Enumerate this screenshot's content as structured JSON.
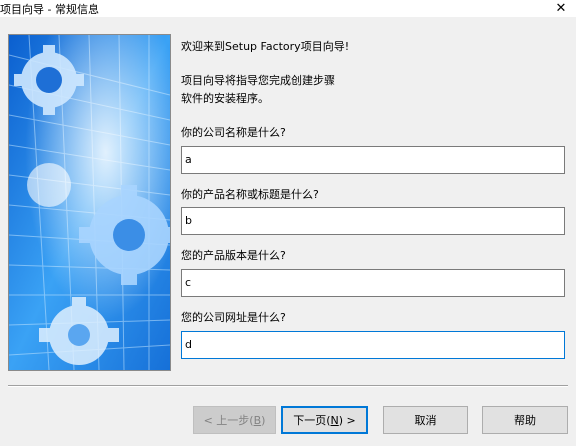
{
  "window": {
    "title": "项目向导 - 常规信息",
    "close_glyph": "✕"
  },
  "wizard": {
    "welcome": "欢迎来到Setup Factory项目向导!",
    "intro_line1": "项目向导将指导您完成创建步骤",
    "intro_line2": "软件的安装程序。",
    "fields": [
      {
        "label": "你的公司名称是什么?",
        "value": "a"
      },
      {
        "label": "你的产品名称或标题是什么?",
        "value": "b"
      },
      {
        "label": "您的产品版本是什么?",
        "value": "c"
      },
      {
        "label": "您的公司网址是什么?",
        "value": "d"
      }
    ]
  },
  "buttons": {
    "back": {
      "prefix": "< 上一步(",
      "key": "B",
      "suffix": ")",
      "enabled": false
    },
    "next": {
      "prefix": "下一页(",
      "key": "N",
      "suffix": ") >",
      "is_default": true
    },
    "cancel": "取消",
    "help": "帮助"
  },
  "colors": {
    "focus_border": "#0078d7",
    "image_blue": "#1e88e8"
  },
  "icons": {
    "close": "close-icon",
    "banner": "gears-banner-image"
  }
}
